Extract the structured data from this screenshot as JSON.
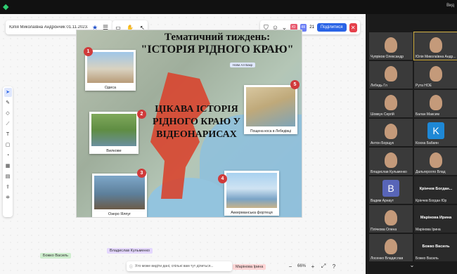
{
  "window": {
    "logo": "◆",
    "topright": "Вид"
  },
  "board": {
    "doc_title": "Юлія Миколаївна Андрончик 01.11.2023...",
    "share_label": "Поділитися",
    "avatar1": "Ю",
    "avatar2": "КК",
    "avatar_count": "21",
    "zoom": "66%",
    "hint_text": "Хто може видіти дані, спільні вам тут ділиться..."
  },
  "slide": {
    "title1": "Тематичний тиждень:",
    "title2": "\"ІСТОРІЯ РІДНОГО КРАЮ\"",
    "subtitle": "ЦІКАВА ІСТОРІЯ РІДНОГО КРАЮ У ВІДЕОНАРИСАХ",
    "cursor_label": "Наїм Ал Бакр",
    "photos": [
      {
        "num": "1",
        "caption": "Одеса"
      },
      {
        "num": "2",
        "caption": "Вилкове"
      },
      {
        "num": "3",
        "caption": "Озеро Ялпуг"
      },
      {
        "num": "4",
        "caption": "Аккерманська фортеця"
      },
      {
        "num": "5",
        "caption": "Пощена коса в Лебедівці"
      }
    ]
  },
  "cursors": [
    {
      "label": "Божко Василь"
    },
    {
      "label": "Владислав Кульменко"
    },
    {
      "label": "Марінова Ірина"
    }
  ],
  "gallery": {
    "participants": [
      {
        "name": "Чупріков Олександр"
      },
      {
        "name": "Юлія Миколаївна Андр..."
      },
      {
        "name": "Лебедь Гл"
      },
      {
        "name": "Рута НОЕ"
      },
      {
        "name": "Шовкун Сергій"
      },
      {
        "name": "Балан Максим"
      },
      {
        "name": "Антон Борщук"
      },
      {
        "name": "Ксюха Бабаян",
        "letter": "K"
      },
      {
        "name": "Владислав Кульменко"
      },
      {
        "name": "Дальгерогло Влад"
      },
      {
        "name": "Вадим Арнаут",
        "letter": "В"
      },
      {
        "name": "Крінчев Богдан Юр",
        "big": "Крінчев Богдан..."
      },
      {
        "name": "Плічкова Олена"
      },
      {
        "name": "Марінова Ірина",
        "big": "Марінова Ирина"
      },
      {
        "name": "Лосенко Владислав"
      },
      {
        "name": "Божко Василь",
        "big": "Божко Василь"
      }
    ]
  }
}
